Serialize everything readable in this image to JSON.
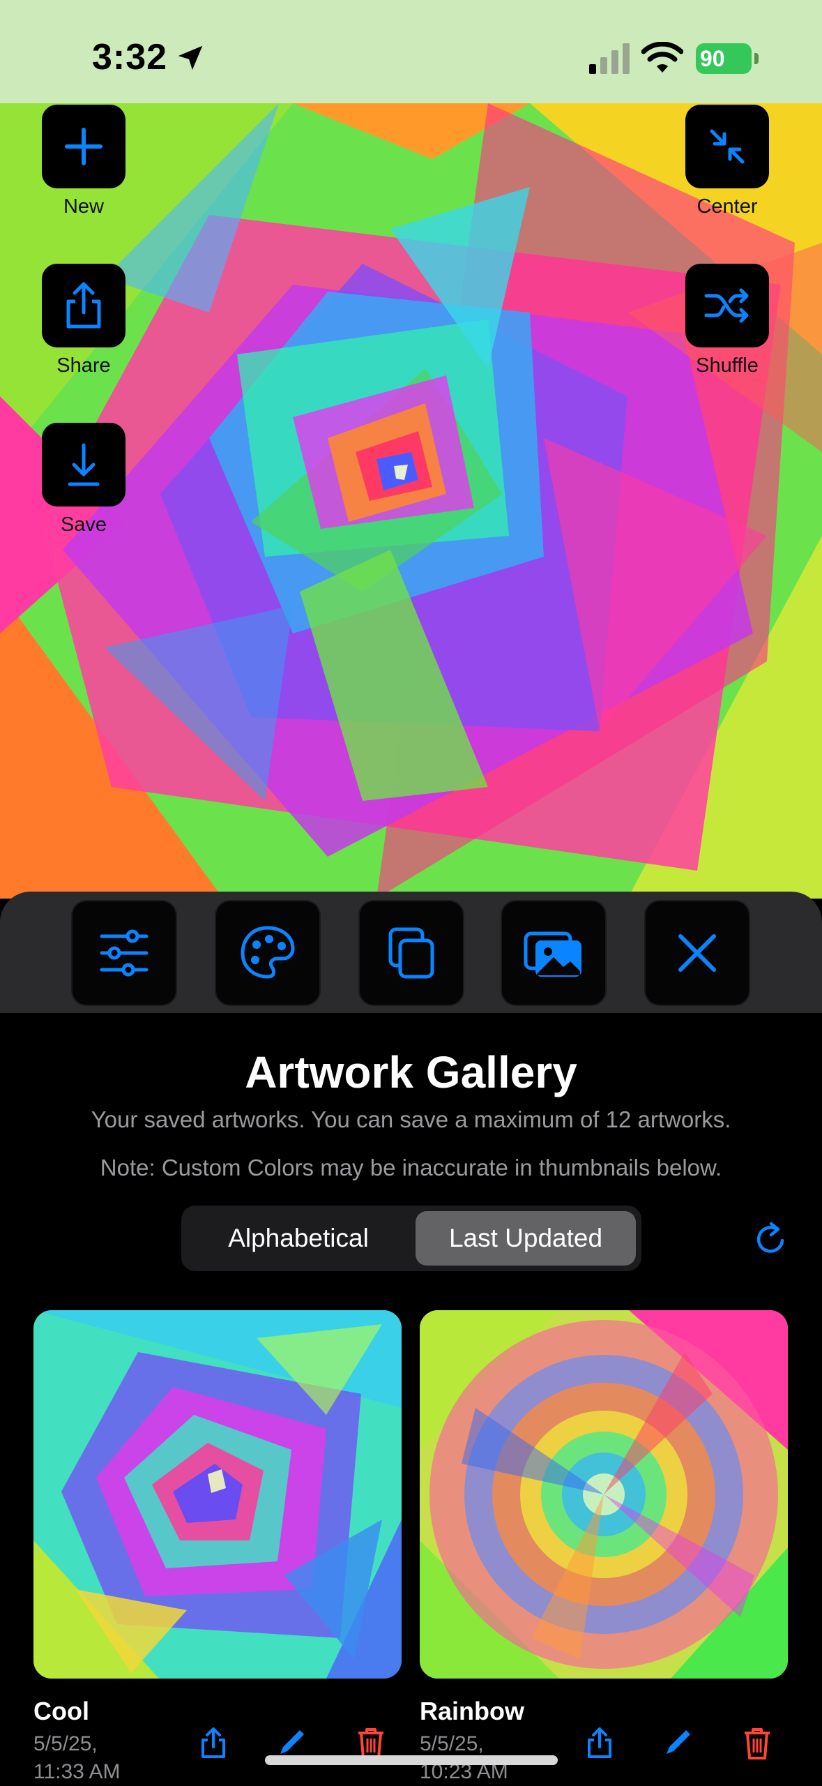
{
  "status_bar": {
    "time": "3:32",
    "battery": "90"
  },
  "canvas_buttons": {
    "new": "New",
    "share": "Share",
    "save": "Save",
    "center": "Center",
    "shuffle": "Shuffle"
  },
  "toolbar": {
    "icons": [
      "sliders-icon",
      "palette-icon",
      "copy-icon",
      "gallery-icon",
      "close-icon"
    ],
    "active_index": 3
  },
  "gallery": {
    "title": "Artwork Gallery",
    "subtitle": "Your saved artworks. You can save a maximum of 12 artworks.",
    "note": "Note: Custom Colors may be inaccurate in thumbnails below.",
    "sort_options": [
      "Alphabetical",
      "Last Updated"
    ],
    "selected_sort": "Last Updated",
    "items": [
      {
        "name": "Cool",
        "date": "5/5/25,",
        "time": "11:33 AM"
      },
      {
        "name": "Rainbow",
        "date": "5/5/25,",
        "time": "10:23 AM"
      }
    ]
  },
  "colors": {
    "accent": "#0a84ff",
    "status_bar_bg": "#cdeabb",
    "delete": "#ff453a"
  }
}
